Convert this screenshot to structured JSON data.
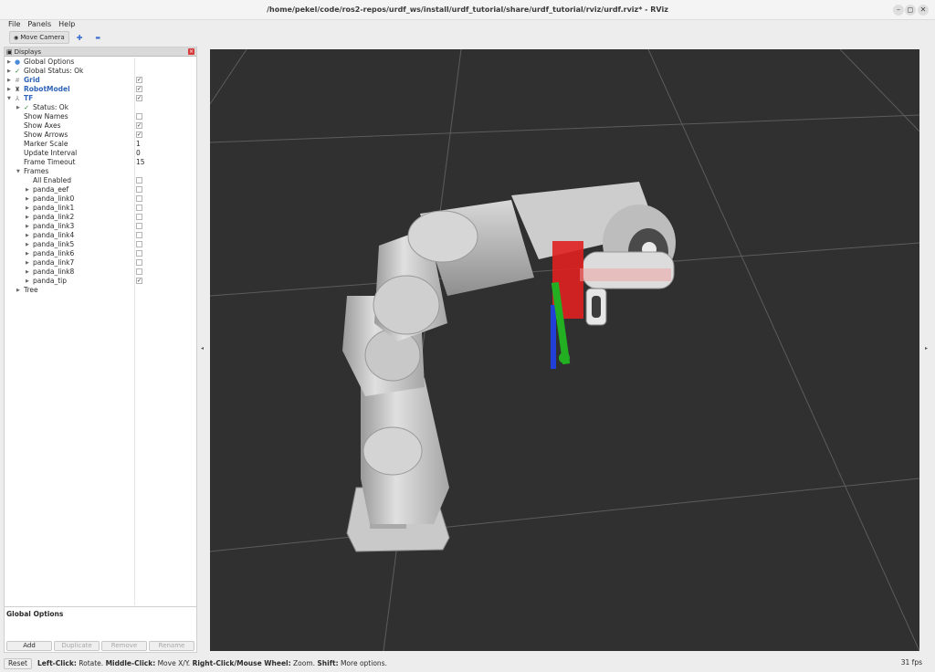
{
  "window": {
    "title": "/home/pekel/code/ros2-repos/urdf_ws/install/urdf_tutorial/share/urdf_tutorial/rviz/urdf.rviz* - RViz",
    "minimize": "–",
    "maximize": "◻",
    "close": "✕"
  },
  "menu": [
    "File",
    "Panels",
    "Help"
  ],
  "toolbar": {
    "move_camera": "Move Camera",
    "move_camera_icon": "camera-icon",
    "add_icon": "✚",
    "remove_icon": "▬"
  },
  "displays": {
    "header": "Displays",
    "items": {
      "global_options": "Global Options",
      "global_status": "Global Status: Ok",
      "grid": "Grid",
      "robot_model": "RobotModel",
      "tf": "TF",
      "status": "Status: Ok",
      "show_names": "Show Names",
      "show_axes": "Show Axes",
      "show_arrows": "Show Arrows",
      "marker_scale": "Marker Scale",
      "marker_scale_value": "1",
      "update_interval": "Update Interval",
      "update_interval_value": "0",
      "frame_timeout": "Frame Timeout",
      "frame_timeout_value": "15",
      "frames": "Frames",
      "all_enabled": "All Enabled",
      "tree": "Tree"
    },
    "frames": [
      "panda_eef",
      "panda_link0",
      "panda_link1",
      "panda_link2",
      "panda_link3",
      "panda_link4",
      "panda_link5",
      "panda_link6",
      "panda_link7",
      "panda_link8",
      "panda_tip"
    ],
    "checked": "✓"
  },
  "description": {
    "title": "Global Options"
  },
  "buttons": {
    "add": "Add",
    "duplicate": "Duplicate",
    "remove": "Remove",
    "rename": "Rename"
  },
  "status": {
    "reset": "Reset",
    "left_click": "Left-Click:",
    "left_click_action": " Rotate. ",
    "middle_click": "Middle-Click:",
    "middle_click_action": " Move X/Y. ",
    "right_click": "Right-Click/Mouse Wheel:",
    "right_click_action": " Zoom. ",
    "shift": "Shift:",
    "shift_action": " More options.",
    "fps": "31 fps"
  },
  "colors": {
    "viewport_bg": "#303030",
    "grid_line": "#5a5a5a",
    "robot_gray": "#cfcfcf",
    "axis_red": "#e02020",
    "axis_green": "#22b022",
    "axis_blue": "#2040d8",
    "display_blue": "#2f64b8"
  }
}
